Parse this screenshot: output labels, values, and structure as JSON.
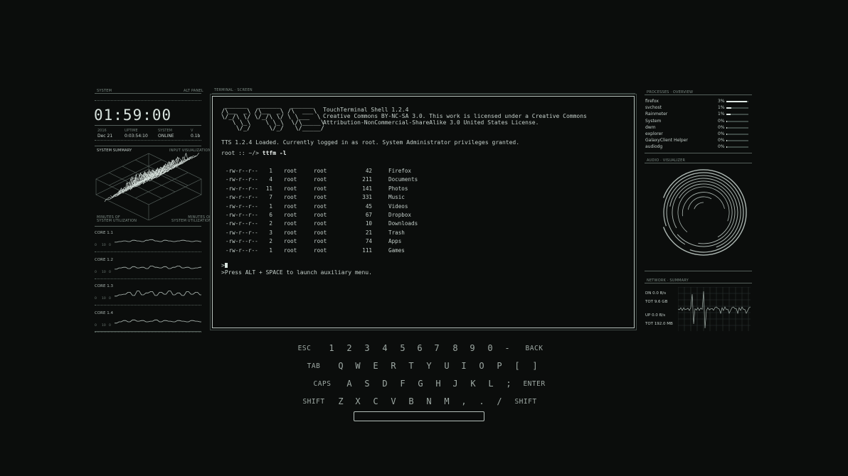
{
  "left_panel": {
    "header_left": "SYSTEM",
    "header_right": "ALT PANEL",
    "clock": "01:59:00",
    "stats": [
      {
        "key": "2016",
        "value": "Dec 21"
      },
      {
        "key": "UPTIME",
        "value": "0:03:54:10"
      },
      {
        "key": "SYSTEM",
        "value": "ONLINE"
      },
      {
        "key": "V",
        "value": "0.1b"
      }
    ],
    "summary_left": "SYSTEM SUMMARY",
    "summary_right": "INPUT VISUALIZATION",
    "chart_caption_left": "MINUTES OF\nSYSTEM UTILIZATION",
    "chart_caption_right": "MINUTES OF\nSYSTEM UTILIZATION",
    "cores": [
      {
        "label": "CORE 1.1",
        "values": [
          0.45,
          0.5,
          0.55,
          0.5,
          0.6,
          0.55,
          0.5,
          0.6,
          0.65,
          0.55,
          0.5,
          0.6,
          0.55,
          0.5,
          0.55,
          0.6,
          0.55,
          0.5,
          0.55,
          0.5
        ]
      },
      {
        "label": "CORE 1.2",
        "values": [
          0.45,
          0.55,
          0.6,
          0.5,
          0.65,
          0.55,
          0.6,
          0.5,
          0.7,
          0.6,
          0.55,
          0.65,
          0.5,
          0.6,
          0.7,
          0.55,
          0.6,
          0.5,
          0.55,
          0.6
        ]
      },
      {
        "label": "CORE 1.3",
        "values": [
          0.4,
          0.5,
          0.55,
          0.7,
          0.45,
          0.8,
          0.5,
          0.65,
          0.75,
          0.45,
          0.7,
          0.55,
          0.8,
          0.5,
          0.65,
          0.45,
          0.75,
          0.55,
          0.7,
          0.5
        ]
      },
      {
        "label": "CORE 1.4",
        "values": [
          0.4,
          0.5,
          0.6,
          0.5,
          0.65,
          0.55,
          0.6,
          0.5,
          0.55,
          0.65,
          0.5,
          0.6,
          0.55,
          0.5,
          0.6,
          0.55,
          0.5,
          0.6,
          0.55,
          0.5
        ]
      }
    ],
    "core_axis": [
      "0",
      "10",
      "0"
    ]
  },
  "terminal": {
    "header": "TERMINAL · SCREEN",
    "ascii_art": " ______   ______   ______ \n/\\__  _\\ /\\__  _\\ /\\  ___\\ \n\\/_/\\ \\/ \\/_/\\ \\/ \\ \\___  \\\n   \\ \\_\\    \\ \\_\\  \\/\\_____\\\n    \\/_/     \\/_/   \\/_____/",
    "title": "TouchTerminal Shell 1.2.4",
    "license_1": "Creative Commons BY-NC-SA 3.0. This work is licensed under a Creative Commons",
    "license_2": "Attribution-NonCommercial-ShareAlike 3.0 United States License.",
    "loaded_msg": "TTS 1.2.4 Loaded. Currently logged in as root. System Administrator privileges granted.",
    "prompt": "root :: ~/> ",
    "command": "ttfm -l",
    "listing": [
      {
        "perm": "-rw-r--r--",
        "links": "1",
        "owner": "root",
        "group": "root",
        "size": "42",
        "name": "Firefox"
      },
      {
        "perm": "-rw-r--r--",
        "links": "4",
        "owner": "root",
        "group": "root",
        "size": "211",
        "name": "Documents"
      },
      {
        "perm": "-rw-r--r--",
        "links": "11",
        "owner": "root",
        "group": "root",
        "size": "141",
        "name": "Photos"
      },
      {
        "perm": "-rw-r--r--",
        "links": "7",
        "owner": "root",
        "group": "root",
        "size": "331",
        "name": "Music"
      },
      {
        "perm": "-rw-r--r--",
        "links": "1",
        "owner": "root",
        "group": "root",
        "size": "45",
        "name": "Videos"
      },
      {
        "perm": "-rw-r--r--",
        "links": "6",
        "owner": "root",
        "group": "root",
        "size": "67",
        "name": "Dropbox"
      },
      {
        "perm": "-rw-r--r--",
        "links": "2",
        "owner": "root",
        "group": "root",
        "size": "10",
        "name": "Downloads"
      },
      {
        "perm": "-rw-r--r--",
        "links": "3",
        "owner": "root",
        "group": "root",
        "size": "21",
        "name": "Trash"
      },
      {
        "perm": "-rw-r--r--",
        "links": "2",
        "owner": "root",
        "group": "root",
        "size": "74",
        "name": "Apps"
      },
      {
        "perm": "-rw-r--r--",
        "links": "1",
        "owner": "root",
        "group": "root",
        "size": "111",
        "name": "Games"
      }
    ],
    "input_prompt": ">",
    "hint": ">Press ALT + SPACE to launch auxiliary menu."
  },
  "right_panel": {
    "processes_header": "PROCESSES · OVERVIEW",
    "processes": [
      {
        "name": "firefox",
        "percent": "3%",
        "level": 0.95
      },
      {
        "name": "svchost",
        "percent": "1%",
        "level": 0.22
      },
      {
        "name": "Rainmeter",
        "percent": "1%",
        "level": 0.2
      },
      {
        "name": "System",
        "percent": "0%",
        "level": 0.04
      },
      {
        "name": "dwm",
        "percent": "0%",
        "level": 0.04
      },
      {
        "name": "explorer",
        "percent": "0%",
        "level": 0.04
      },
      {
        "name": "GalaxyClient Helper",
        "percent": "0%",
        "level": 0.04
      },
      {
        "name": "audiodg",
        "percent": "0%",
        "level": 0.04
      }
    ],
    "audio_header": "AUDIO · VISUALIZER",
    "network_header": "NETWORK · SUMMARY",
    "network": [
      {
        "label": "DN",
        "value": "0.0 B/s"
      },
      {
        "label": "TOT",
        "value": "9.6 GB"
      },
      {
        "label": "UP",
        "value": "0.0 B/s"
      },
      {
        "label": "TOT",
        "value": "192.0 MB"
      }
    ]
  },
  "keyboard": {
    "rows": [
      [
        "ESC",
        "1",
        "2",
        "3",
        "4",
        "5",
        "6",
        "7",
        "8",
        "9",
        "0",
        "-",
        "BACK"
      ],
      [
        "TAB",
        "Q",
        "W",
        "E",
        "R",
        "T",
        "Y",
        "U",
        "I",
        "O",
        "P",
        "[",
        "]"
      ],
      [
        "CAPS",
        "A",
        "S",
        "D",
        "F",
        "G",
        "H",
        "J",
        "K",
        "L",
        ";",
        "ENTER"
      ],
      [
        "SHIFT",
        "Z",
        "X",
        "C",
        "V",
        "B",
        "N",
        "M",
        ",",
        ".",
        "/",
        "SHIFT"
      ]
    ]
  },
  "colors": {
    "background": "#0b0d0c",
    "text": "#c4cfca",
    "accent": "#dfe8e4",
    "muted": "#55605b"
  }
}
